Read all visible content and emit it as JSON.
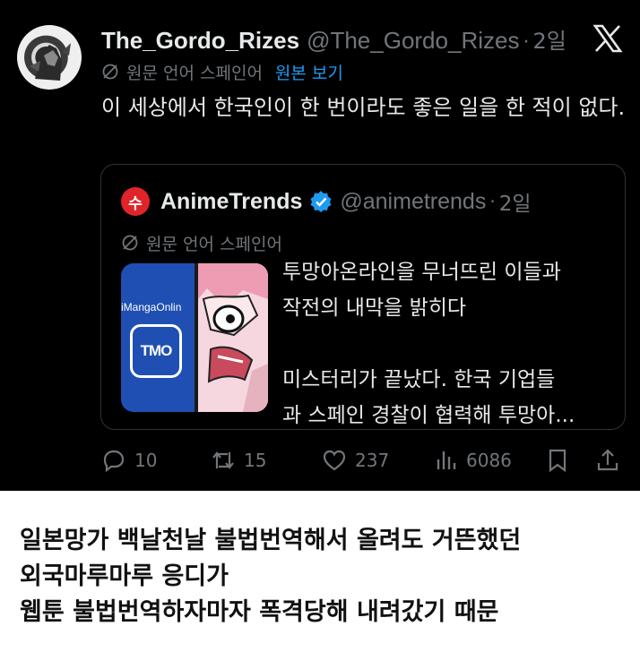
{
  "tweet": {
    "author_name": "The_Gordo_Rizes",
    "author_handle": "@The_Gordo_Rizes",
    "age": "2일",
    "source_language": "원문 언어 스페인어",
    "show_original": "원본 보기",
    "text": "이 세상에서 한국인이 한 번이라도 좋은 일을 한 적이 없다."
  },
  "quote": {
    "logo_text": "수",
    "author_name": "AnimeTrends",
    "author_handle": "@animetrends",
    "age": "2일",
    "source_language": "원문 언어 스페인어",
    "thumbnail_brand": "iMangaOnlin",
    "thumbnail_badge": "TMO",
    "text_lines": [
      "투망아온라인을 무너뜨린 이들과",
      "작전의 내막을 밝히다",
      "미스터리가 끝났다. 한국 기업들",
      "과 스페인 경찰이 협력해 투망아..."
    ]
  },
  "actions": {
    "replies": "10",
    "reposts": "15",
    "likes": "237",
    "views": "6086"
  },
  "caption": {
    "lines": [
      "일본망가 백날천날 불법번역해서 올려도 거뜬했던",
      "외국마루마루 응디가",
      "웹툰 불법번역하자마자 폭격당해 내려갔기 때문"
    ]
  },
  "colors": {
    "background": "#000000",
    "text_primary": "#e7e9ea",
    "text_secondary": "#71767b",
    "link": "#1d9bf0",
    "verified": "#1d9bf0",
    "brand_red": "#e0242a",
    "tmo_blue": "#1f4fb2"
  },
  "icons": [
    "globe-slash-icon",
    "x-logo-icon",
    "verified-badge-icon",
    "reply-icon",
    "repost-icon",
    "like-icon",
    "views-icon",
    "bookmark-icon",
    "share-icon"
  ]
}
